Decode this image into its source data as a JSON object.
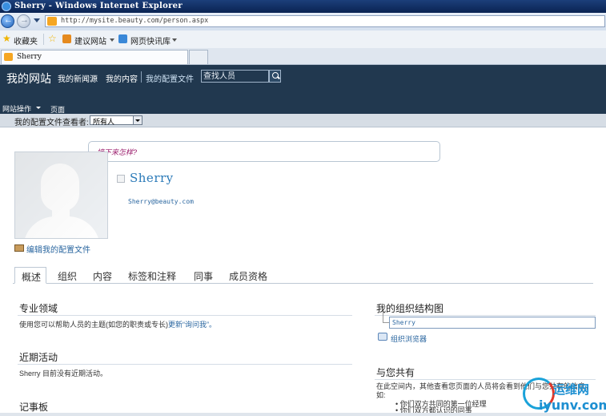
{
  "browser": {
    "window_title": "Sherry - Windows Internet Explorer",
    "url": "http://mysite.beauty.com/person.aspx",
    "favorites_label": "收藏夹",
    "suggested_sites_label": "建议网站",
    "web_slice_label": "网页快讯库",
    "tab_title": "Sherry"
  },
  "site": {
    "name": "我的网站",
    "nav": [
      "我的新闻源",
      "我的内容",
      "我的配置文件"
    ],
    "search_placeholder": "查找人员",
    "site_actions_label": "网站操作",
    "page_label": "页面"
  },
  "viewer": {
    "label": "我的配置文件查看者:",
    "selected": "所有人"
  },
  "profile": {
    "status_prompt": "接下来怎样?",
    "name": "Sherry",
    "email": "Sherry@beauty.com",
    "edit_link": "编辑我的配置文件"
  },
  "tabs": [
    "概述",
    "组织",
    "内容",
    "标签和注释",
    "同事",
    "成员资格"
  ],
  "sections": {
    "expertise_title": "专业领域",
    "expertise_text": "使用您可以帮助人员的主题(如您的职责或专长)",
    "expertise_link": "更新“询问我”。",
    "activity_title": "近期活动",
    "activity_text": "Sherry 目前没有近期活动。",
    "notes_title": "记事板",
    "org_title": "我的组织结构图",
    "org_person": "Sherry",
    "org_browser": "组织浏览器",
    "shared_title": "与您共有",
    "shared_text": "在此空间内，其他查看您页面的人员将会看到他们与您共有的信息，如:",
    "shared_items": [
      "你们双方共同的第一位经理",
      "你们双方都认识的同事"
    ]
  },
  "watermark": {
    "cn": "运维网",
    "en": "iyunv.com"
  }
}
